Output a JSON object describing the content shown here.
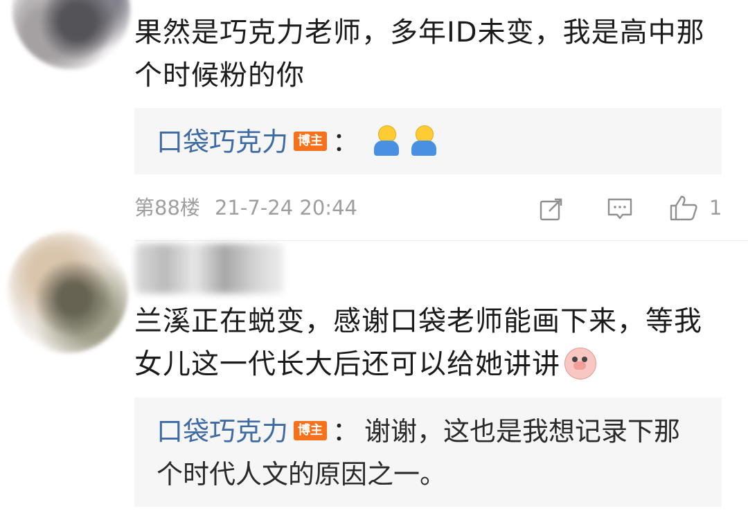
{
  "comments": [
    {
      "text": "果然是巧克力老师，多年ID未变，我是高中那个时候粉的你",
      "reply": {
        "author": "口袋巧克力",
        "badge": "博主",
        "colon": "：",
        "content": ""
      },
      "meta": {
        "floor": "第88楼",
        "time": "21-7-24 20:44",
        "likes": "1"
      }
    },
    {
      "text": "兰溪正在蜕变，感谢口袋老师能画下来，等我女儿这一代长大后还可以给她讲讲",
      "reply": {
        "author": "口袋巧克力",
        "badge": "博主",
        "colon": "：",
        "content": "谢谢，这也是我想记录下那个时代人文的原因之一。"
      }
    }
  ],
  "icons": {
    "shrug": "shrug-emoji-icon",
    "pig": "pig-emoji-icon",
    "repost": "repost-icon",
    "comment": "comment-icon",
    "like": "like-icon"
  },
  "colors": {
    "reply_author": "#3d6aa2",
    "badge": "#f5711c",
    "meta": "#9e9e9e",
    "reply_bg": "#f6f6f6"
  }
}
